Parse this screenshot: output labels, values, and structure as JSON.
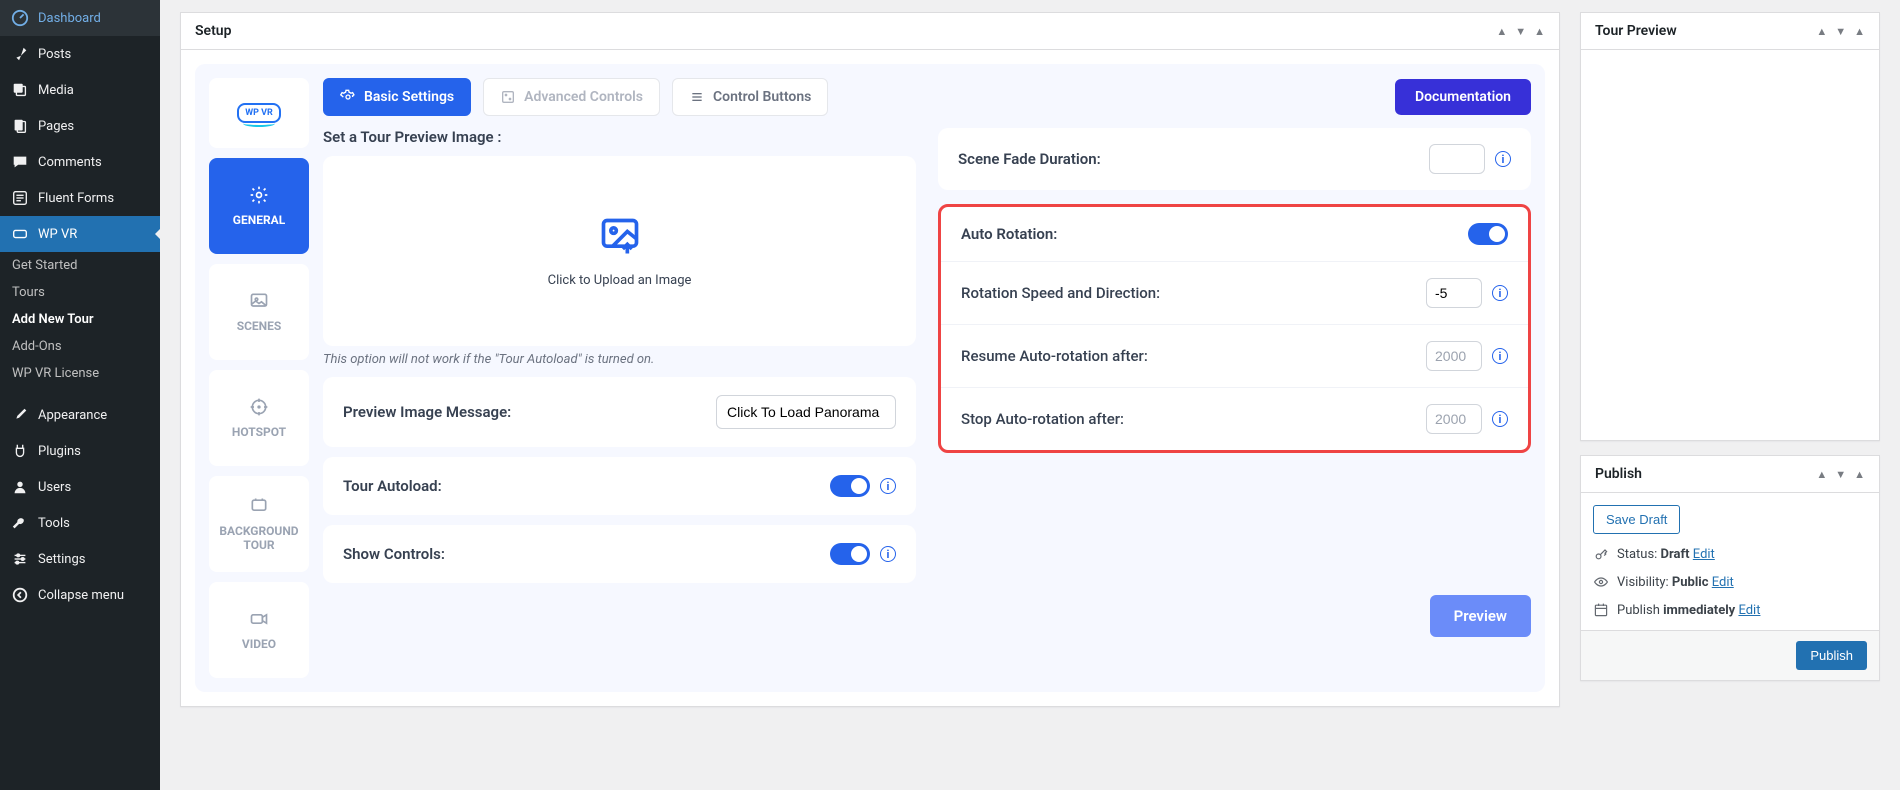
{
  "sidebar": {
    "items": [
      {
        "label": "Dashboard"
      },
      {
        "label": "Posts"
      },
      {
        "label": "Media"
      },
      {
        "label": "Pages"
      },
      {
        "label": "Comments"
      },
      {
        "label": "Fluent Forms"
      },
      {
        "label": "WP VR"
      }
    ],
    "submenu": [
      {
        "label": "Get Started"
      },
      {
        "label": "Tours"
      },
      {
        "label": "Add New Tour"
      },
      {
        "label": "Add-Ons"
      },
      {
        "label": "WP VR License"
      }
    ],
    "items2": [
      {
        "label": "Appearance"
      },
      {
        "label": "Plugins"
      },
      {
        "label": "Users"
      },
      {
        "label": "Tools"
      },
      {
        "label": "Settings"
      },
      {
        "label": "Collapse menu"
      }
    ]
  },
  "setup": {
    "title": "Setup",
    "logo_text": "WP VR",
    "sidetabs": [
      {
        "label": "GENERAL"
      },
      {
        "label": "SCENES"
      },
      {
        "label": "HOTSPOT"
      },
      {
        "label": "BACKGROUND TOUR"
      },
      {
        "label": "VIDEO"
      }
    ],
    "top_tabs": {
      "basic": "Basic Settings",
      "advanced": "Advanced Controls",
      "control": "Control Buttons",
      "documentation": "Documentation"
    },
    "left": {
      "section_label": "Set a Tour Preview Image :",
      "upload_text": "Click to Upload an Image",
      "hint": "This option will not work if the \"Tour Autoload\" is turned on.",
      "preview_msg_label": "Preview Image Message:",
      "preview_msg_value": "Click To Load Panorama",
      "autoload_label": "Tour Autoload:",
      "show_controls_label": "Show Controls:"
    },
    "right": {
      "fade_label": "Scene Fade Duration:",
      "fade_value": "",
      "auto_label": "Auto Rotation:",
      "speed_label": "Rotation Speed and Direction:",
      "speed_value": "-5",
      "resume_label": "Resume Auto-rotation after:",
      "resume_placeholder": "2000",
      "stop_label": "Stop Auto-rotation after:",
      "stop_placeholder": "2000"
    },
    "preview_btn": "Preview"
  },
  "tour_preview": {
    "title": "Tour Preview"
  },
  "publish": {
    "title": "Publish",
    "save_draft": "Save Draft",
    "status_label": "Status: ",
    "status_value": "Draft",
    "visibility_label": "Visibility: ",
    "visibility_value": "Public",
    "publish_label": "Publish ",
    "publish_value": "immediately",
    "edit": "Edit",
    "publish_btn": "Publish"
  }
}
